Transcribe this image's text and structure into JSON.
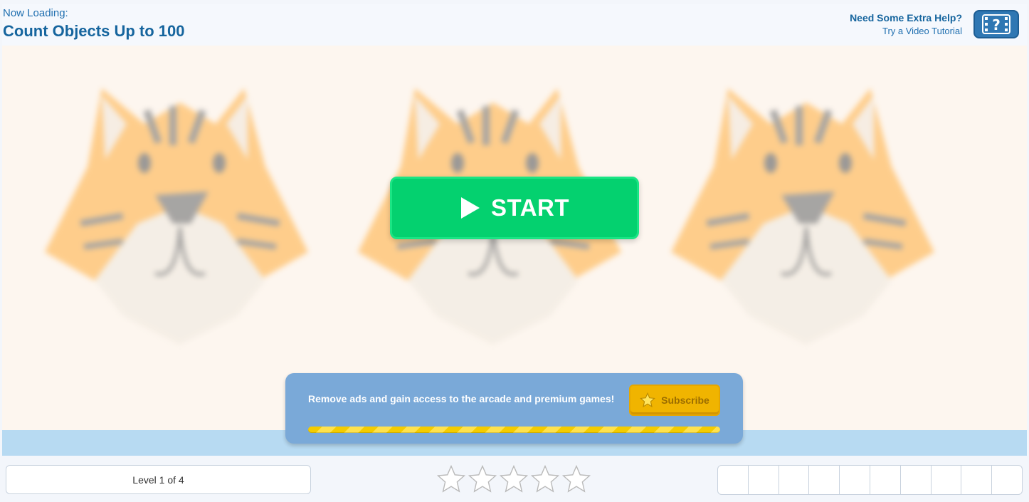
{
  "header": {
    "loading_label": "Now Loading:",
    "title": "Count Objects Up to 100",
    "help_title": "Need Some Extra Help?",
    "help_subtitle": "Try a Video Tutorial",
    "video_icon": "film-question-icon"
  },
  "stage": {
    "background_objects": [
      "tiger",
      "tiger",
      "tiger"
    ],
    "start_label": "START",
    "start_icon": "play-icon"
  },
  "promo": {
    "text": "Remove ads and gain access to the arcade and premium games!",
    "subscribe_label": "Subscribe",
    "subscribe_icon": "star-icon"
  },
  "footer": {
    "level_text": "Level 1 of 4",
    "stars_total": 5,
    "stars_earned": 0,
    "score_cells": 10
  },
  "colors": {
    "brand_blue": "#16659e",
    "start_green": "#04d16f",
    "promo_blue": "#7aa9d8",
    "subscribe_gold": "#f0b400"
  }
}
